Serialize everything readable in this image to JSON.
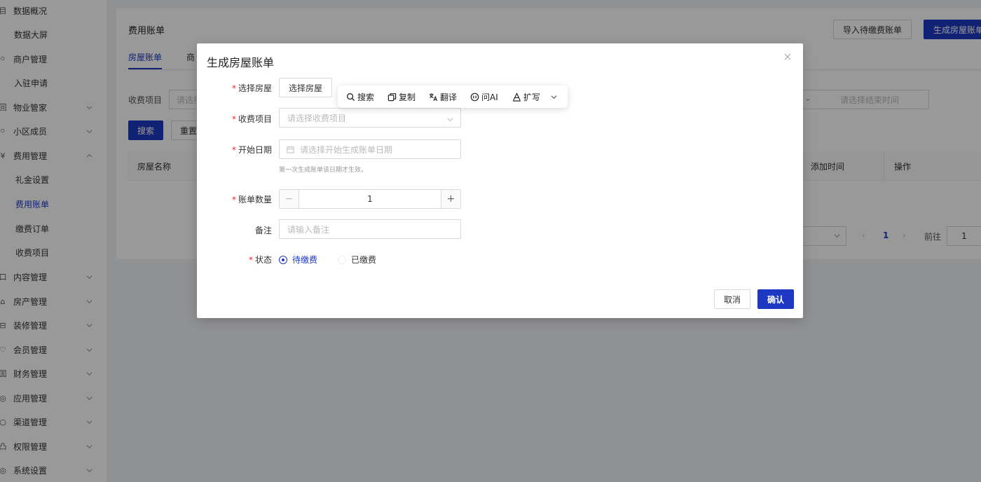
{
  "sidebar": {
    "items": [
      {
        "label": "数据概况",
        "icon": "data-overview-icon"
      },
      {
        "label": "数据大屏"
      },
      {
        "label": "商户管理",
        "icon": "merchant-icon"
      },
      {
        "label": "入驻申请"
      },
      {
        "label": "物业管家",
        "icon": "property-steward-icon"
      },
      {
        "label": "小区成员",
        "icon": "community-members-icon"
      },
      {
        "label": "费用管理",
        "icon": "fee-management-icon"
      },
      {
        "label": "礼金设置"
      },
      {
        "label": "费用账单"
      },
      {
        "label": "缴费订单"
      },
      {
        "label": "收费项目"
      },
      {
        "label": "内容管理",
        "icon": "content-icon"
      },
      {
        "label": "房产管理",
        "icon": "real-estate-icon"
      },
      {
        "label": "装修管理",
        "icon": "renovation-icon"
      },
      {
        "label": "会员管理",
        "icon": "member-icon"
      },
      {
        "label": "财务管理",
        "icon": "finance-icon"
      },
      {
        "label": "应用管理",
        "icon": "app-icon"
      },
      {
        "label": "渠道管理",
        "icon": "channel-icon"
      },
      {
        "label": "权限管理",
        "icon": "permission-icon"
      },
      {
        "label": "系统设置",
        "icon": "settings-icon"
      }
    ],
    "icon_glyphs": [
      "目",
      "",
      "ဝ",
      "",
      "回",
      "ဝ",
      "¥",
      "",
      "",
      "",
      "",
      "口",
      "⌂",
      "⊟",
      "♡",
      "囯",
      "◎",
      "○",
      "凸",
      "◎"
    ]
  },
  "main": {
    "title": "费用账单",
    "import_button": "导入待缴费账单",
    "generate_button": "生成房屋账单",
    "tabs": [
      "房屋账单",
      "商"
    ],
    "filter": {
      "label": "收费项目",
      "placeholder": "请选择",
      "date_separator": "-",
      "end_placeholder": "请选择结束时间"
    },
    "search_button": "搜索",
    "reset_button": "重置",
    "table": {
      "columns": [
        "房屋名称",
        "添加时间",
        "操作"
      ]
    },
    "pager": {
      "prev": "‹",
      "current": "1",
      "next": "›",
      "goto_label": "前往",
      "goto_value": "1"
    }
  },
  "modal": {
    "title": "生成房屋账单",
    "fields": {
      "house_label": "选择房屋",
      "house_button": "选择房屋",
      "item_label": "收费项目",
      "item_placeholder": "请选择收费项目",
      "start_label": "开始日期",
      "start_placeholder": "请选择开始生成账单日期",
      "start_hint": "第一次生成账单该日期才生效。",
      "count_label": "账单数量",
      "count_minus": "−",
      "count_value": "1",
      "count_plus": "+",
      "remark_label": "备注",
      "remark_placeholder": "请输入备注",
      "status_label": "状态",
      "status_options": [
        "待缴费",
        "已缴费"
      ],
      "status_selected": "待缴费"
    },
    "cancel_button": "取消",
    "confirm_button": "确认"
  },
  "float_toolbar": {
    "items": [
      {
        "label": "搜索",
        "icon": "search-icon"
      },
      {
        "label": "复制",
        "icon": "copy-icon"
      },
      {
        "label": "翻译",
        "icon": "translate-icon"
      },
      {
        "label": "问AI",
        "icon": "ai-icon"
      },
      {
        "label": "扩写",
        "icon": "expand-write-icon"
      }
    ]
  },
  "colors": {
    "accent": "#1d39c4",
    "required": "#f5222d",
    "mask": "rgba(0,0,0,0.4)"
  }
}
